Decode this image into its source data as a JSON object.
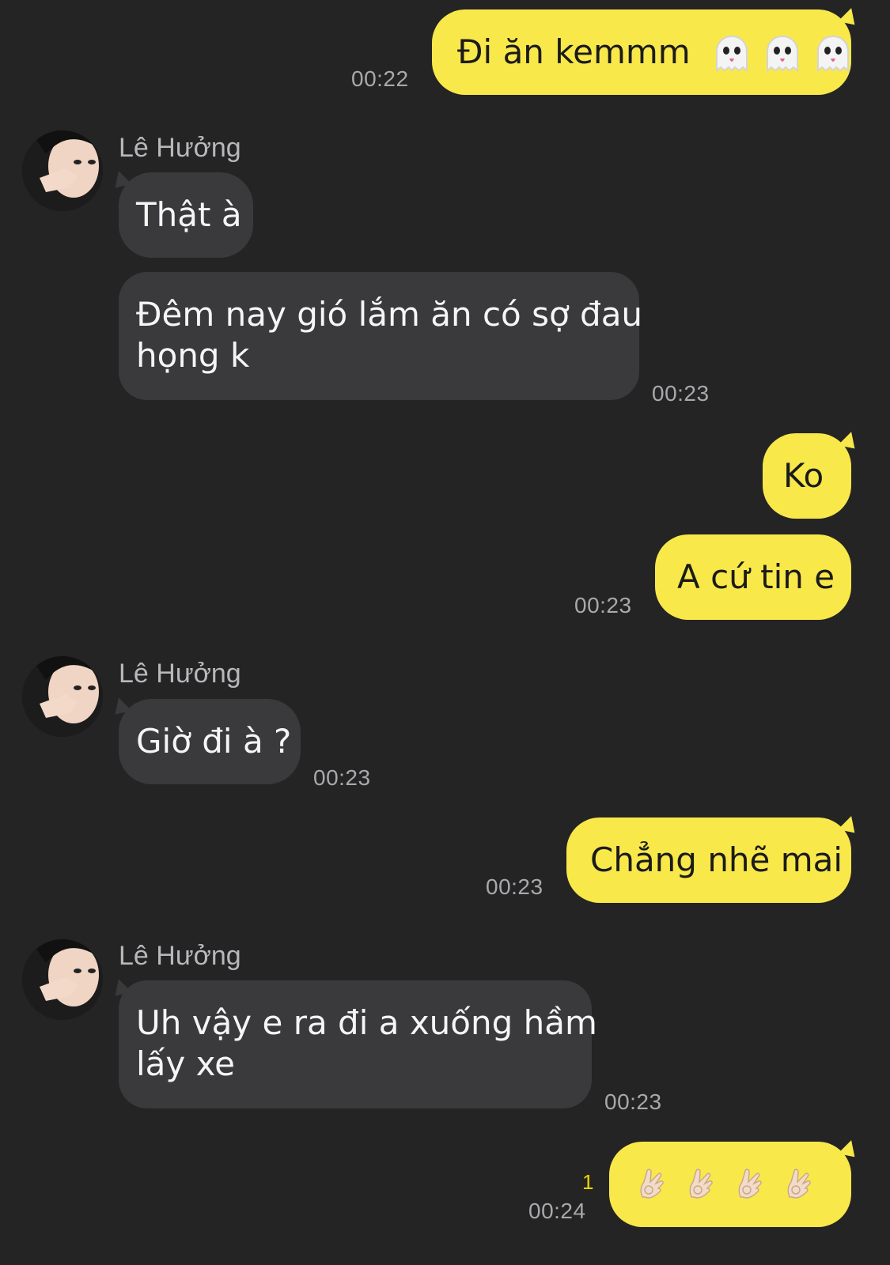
{
  "contact_name": "Lê Hưởng",
  "colors": {
    "background": "#242424",
    "my_bubble": "#f9e84a",
    "their_bubble": "#3a3a3c",
    "timestamp": "#a9a9ad",
    "unread_count": "#f2d400"
  },
  "messages": [
    {
      "text": "Đi ăn kemmm",
      "emoji": [
        "ghost",
        "ghost",
        "ghost"
      ],
      "time": "00:22"
    },
    {
      "sender": "Lê Hưởng",
      "text": "Thật à"
    },
    {
      "text_line1": "Đêm nay gió lắm ăn có sợ đau",
      "text_line2": "họng k",
      "time": "00:23"
    },
    {
      "text": "Ko"
    },
    {
      "text": "A cứ tin e",
      "time": "00:23"
    },
    {
      "sender": "Lê Hưởng",
      "text": "Giờ đi à ?",
      "time": "00:23"
    },
    {
      "text": "Chẳng nhẽ mai",
      "time": "00:23"
    },
    {
      "sender": "Lê Hưởng",
      "text_line1": "Uh vậy e ra đi a xuống hầm",
      "text_line2": "lấy xe",
      "time": "00:23"
    },
    {
      "emoji": [
        "ok-hand",
        "ok-hand",
        "ok-hand",
        "ok-hand"
      ],
      "unread": "1",
      "time": "00:24"
    }
  ]
}
